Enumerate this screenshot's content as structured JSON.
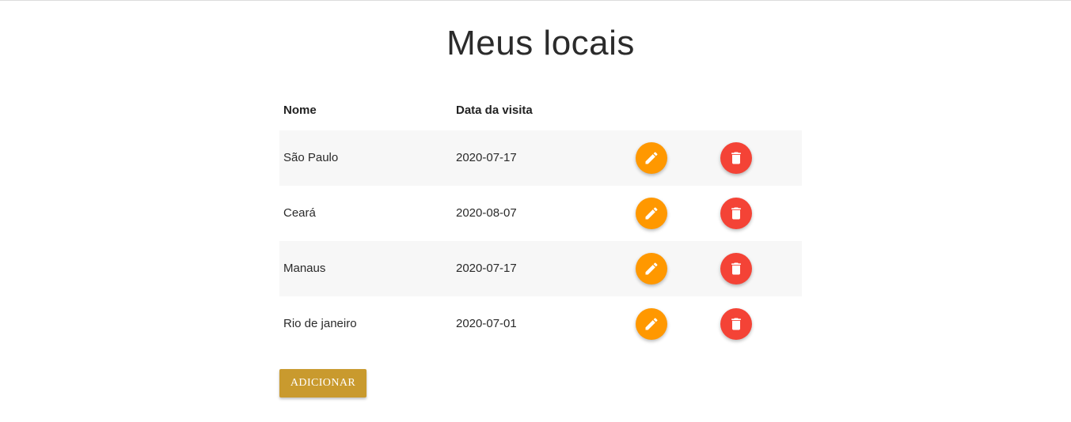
{
  "page": {
    "title": "Meus locais"
  },
  "table": {
    "headers": {
      "name": "Nome",
      "date": "Data da visita"
    },
    "rows": [
      {
        "name": "São Paulo",
        "date": "2020-07-17"
      },
      {
        "name": "Ceará",
        "date": "2020-08-07"
      },
      {
        "name": "Manaus",
        "date": "2020-07-17"
      },
      {
        "name": "Rio de janeiro",
        "date": "2020-07-01"
      }
    ]
  },
  "actions": {
    "edit_icon": "pencil-icon",
    "delete_icon": "trash-icon",
    "add_label": "ADICIONAR"
  },
  "colors": {
    "edit": "#ff9800",
    "delete": "#f44336",
    "add_button": "#c99a2e",
    "row_alt": "#f7f7f7"
  }
}
